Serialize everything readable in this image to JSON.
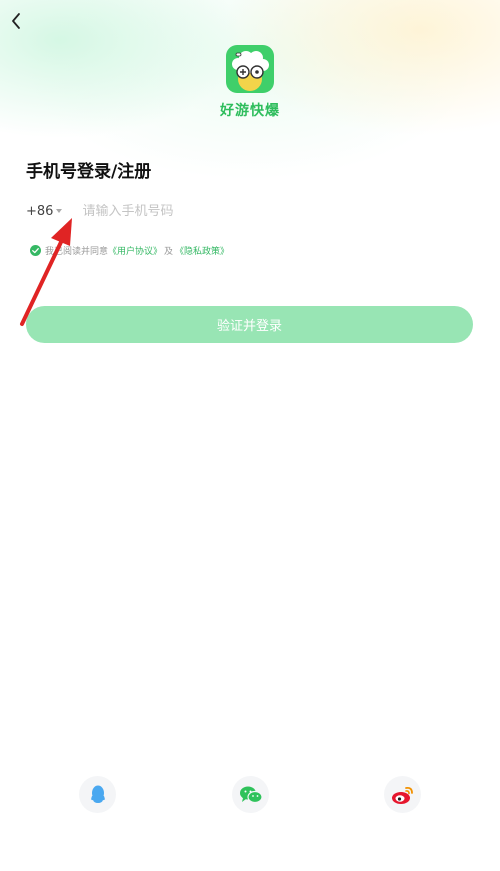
{
  "app": {
    "name": "好游快爆"
  },
  "title": "手机号登录/注册",
  "phone": {
    "country_code": "+86",
    "placeholder": "请输入手机号码",
    "value": ""
  },
  "agreement": {
    "prefix": "我已阅读并同意",
    "user_agreement": "《用户协议》",
    "and": "及",
    "privacy_policy": "《隐私政策》",
    "checked": true
  },
  "login_button_label": "验证并登录",
  "social_logins": [
    "qq-icon",
    "wechat-icon",
    "weibo-icon"
  ],
  "colors": {
    "brand_green": "#3fcf6a",
    "link_green": "#35b864",
    "button_disabled": "#98e5b4",
    "annotation_arrow": "#e02424"
  }
}
